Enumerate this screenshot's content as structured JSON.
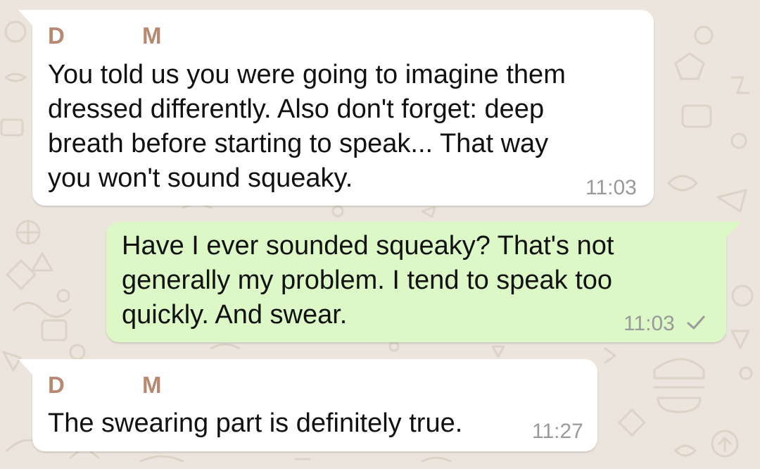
{
  "chat": {
    "background_color": "#ece5dd",
    "incoming_color": "#ffffff",
    "outgoing_color": "#dcf8c6",
    "sender_name_color": "#b88971"
  },
  "messages": [
    {
      "direction": "incoming",
      "sender_first": "D",
      "sender_last": "M",
      "lines": [
        "You told us you were going to imagine them",
        "dressed differently. Also don't forget: deep",
        "breath before starting to speak... That way",
        "you won't sound squeaky."
      ],
      "time": "11:03"
    },
    {
      "direction": "outgoing",
      "lines": [
        "Have I ever sounded squeaky? That's not",
        "generally my problem. I tend to speak too",
        "quickly. And swear."
      ],
      "time": "11:03",
      "status_icon": "single-check-icon"
    },
    {
      "direction": "incoming",
      "sender_first": "D",
      "sender_last": "M",
      "lines": [
        "The swearing part is definitely true."
      ],
      "time": "11:27"
    }
  ]
}
